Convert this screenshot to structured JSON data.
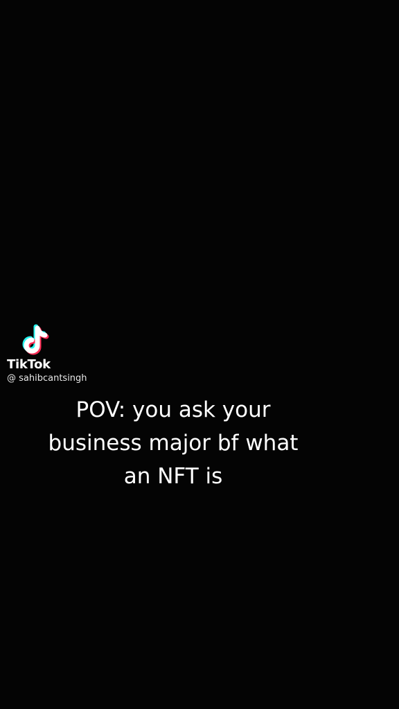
{
  "watermark": {
    "brand": "TikTok",
    "handle": "@ sahibcantsingh",
    "logo_icon": "tiktok-note-icon"
  },
  "caption": {
    "lines": [
      "POV: you ask your",
      "business major bf what",
      "an NFT is"
    ]
  },
  "colors": {
    "background": "#040404",
    "text": "#ffffff",
    "logo_cyan": "#25f4ee",
    "logo_red": "#fe2c55"
  }
}
